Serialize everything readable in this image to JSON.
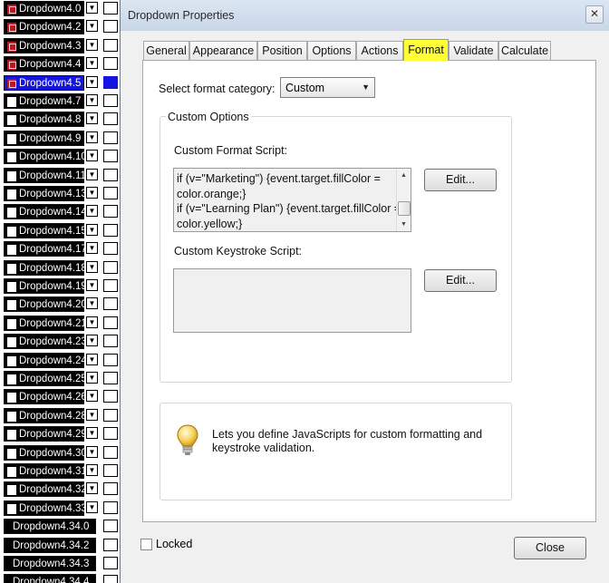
{
  "background_form": {
    "fields": [
      {
        "label": "Dropdown4.0",
        "marker": "red"
      },
      {
        "label": "Dropdown4.2",
        "marker": "red"
      },
      {
        "label": "Dropdown4.3",
        "marker": "red"
      },
      {
        "label": "Dropdown4.4",
        "marker": "red"
      },
      {
        "label": "Dropdown4.5",
        "marker": "red",
        "selected": true
      },
      {
        "label": "Dropdown4.7",
        "marker": "white"
      },
      {
        "label": "Dropdown4.8",
        "marker": "white"
      },
      {
        "label": "Dropdown4.9",
        "marker": "white"
      },
      {
        "label": "Dropdown4.10",
        "marker": "white"
      },
      {
        "label": "Dropdown4.11",
        "marker": "white"
      },
      {
        "label": "Dropdown4.13",
        "marker": "white"
      },
      {
        "label": "Dropdown4.14",
        "marker": "white"
      },
      {
        "label": "Dropdown4.15",
        "marker": "white"
      },
      {
        "label": "Dropdown4.17",
        "marker": "white"
      },
      {
        "label": "Dropdown4.18",
        "marker": "white"
      },
      {
        "label": "Dropdown4.19",
        "marker": "white"
      },
      {
        "label": "Dropdown4.20",
        "marker": "white"
      },
      {
        "label": "Dropdown4.21",
        "marker": "white"
      },
      {
        "label": "Dropdown4.23",
        "marker": "white"
      },
      {
        "label": "Dropdown4.24",
        "marker": "white"
      },
      {
        "label": "Dropdown4.25",
        "marker": "white"
      },
      {
        "label": "Dropdown4.26",
        "marker": "white"
      },
      {
        "label": "Dropdown4.28",
        "marker": "white"
      },
      {
        "label": "Dropdown4.29",
        "marker": "white"
      },
      {
        "label": "Dropdown4.30",
        "marker": "white"
      },
      {
        "label": "Dropdown4.31",
        "marker": "white"
      },
      {
        "label": "Dropdown4.32",
        "marker": "white"
      },
      {
        "label": "Dropdown4.33",
        "marker": "white"
      },
      {
        "label": "Dropdown4.34.0",
        "marker": "white",
        "wide": true
      },
      {
        "label": "Dropdown4.34.2",
        "marker": "white",
        "wide": true
      },
      {
        "label": "Dropdown4.34.3",
        "marker": "white",
        "wide": true
      },
      {
        "label": "Dropdown4.34.4",
        "marker": "white",
        "wide": true
      }
    ],
    "dropdown_icon": "chevron-down-icon"
  },
  "dialog": {
    "title": "Dropdown Properties",
    "close_glyph": "✕",
    "tabs": [
      "General",
      "Appearance",
      "Position",
      "Options",
      "Actions",
      "Format",
      "Validate",
      "Calculate"
    ],
    "active_tab": "Format",
    "active_tab_color": "#ffff33",
    "format_category": {
      "label": "Select format category:",
      "value": "Custom"
    },
    "custom_options": {
      "title": "Custom Options",
      "format_script": {
        "label": "Custom Format Script:",
        "lines": [
          "if (v=\"Marketing\") {event.target.fillColor =",
          "color.orange;}",
          "if (v=\"Learning Plan\") {event.target.fillColor =",
          "color.yellow;}"
        ],
        "edit_label": "Edit..."
      },
      "keystroke_script": {
        "label": "Custom Keystroke Script:",
        "lines": [],
        "edit_label": "Edit..."
      }
    },
    "tip": {
      "icon": "lightbulb-icon",
      "text": "Lets you define JavaScripts for custom formatting and keystroke validation."
    },
    "locked_label": "Locked",
    "locked_checked": false,
    "close_label": "Close"
  }
}
